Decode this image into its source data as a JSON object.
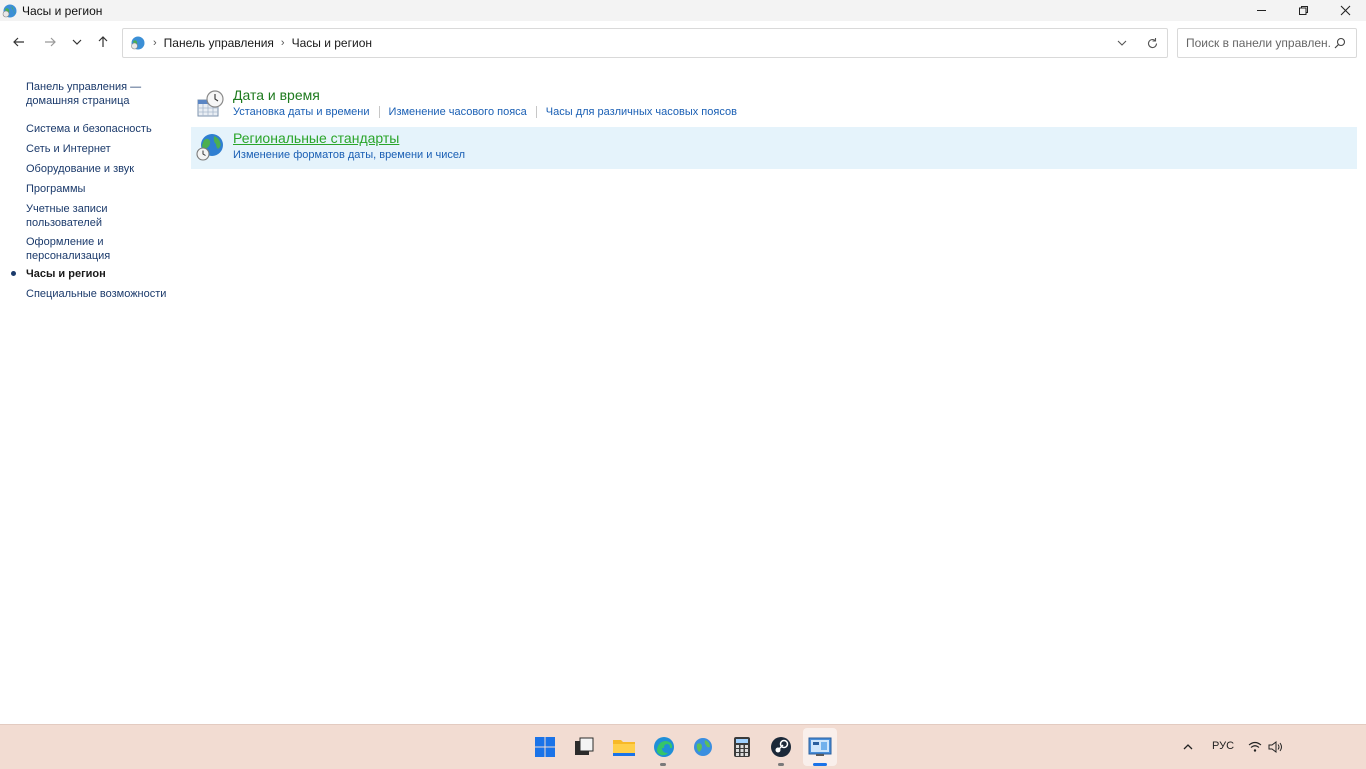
{
  "window": {
    "title": "Часы и регион"
  },
  "navigation": {
    "breadcrumbs": [
      "Панель управления",
      "Часы и регион"
    ],
    "search_placeholder": "Поиск в панели управлен..."
  },
  "sidebar": {
    "home_link": "Панель управления — домашняя страница",
    "items": [
      {
        "label": "Система и безопасность",
        "active": false
      },
      {
        "label": "Сеть и Интернет",
        "active": false
      },
      {
        "label": "Оборудование и звук",
        "active": false
      },
      {
        "label": "Программы",
        "active": false
      },
      {
        "label": "Учетные записи пользователей",
        "active": false
      },
      {
        "label": "Оформление и персонализация",
        "active": false
      },
      {
        "label": "Часы и регион",
        "active": true
      },
      {
        "label": "Специальные возможности",
        "active": false
      }
    ]
  },
  "main": {
    "categories": [
      {
        "title": "Дата и время",
        "icon": "date-time-icon",
        "links": [
          "Установка даты и времени",
          "Изменение часового пояса",
          "Часы для различных часовых поясов"
        ]
      },
      {
        "title": "Региональные стандарты",
        "icon": "region-globe-icon",
        "highlighted": true,
        "links": [
          "Изменение форматов даты, времени и чисел"
        ]
      }
    ]
  },
  "taskbar": {
    "apps": [
      "start-icon",
      "task-view-icon",
      "file-explorer-icon",
      "edge-icon",
      "globe-app-icon",
      "calculator-icon",
      "steam-icon",
      "control-panel-icon"
    ],
    "language": "РУС"
  },
  "colors": {
    "category_title": "#1e7a1e",
    "link": "#1a5fb4",
    "sidebar_link": "#1b3a6b",
    "hover_bg": "#e5f3fb",
    "taskbar_bg": "#f2dcd2"
  }
}
